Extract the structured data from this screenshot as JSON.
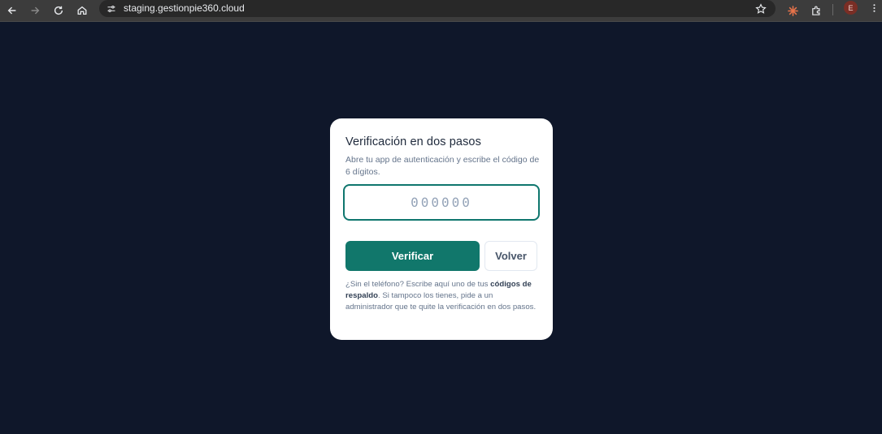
{
  "browser": {
    "url": "staging.gestionpie360.cloud",
    "profile_initial": "E",
    "profile_color": "#7a2e25"
  },
  "card": {
    "title": "Verificación en dos pasos",
    "subtitle": "Abre tu app de autenticación y escribe el código de 6 dígitos.",
    "code_input": {
      "value": "",
      "placeholder": "000000"
    },
    "verify_label": "Verificar",
    "back_label": "Volver",
    "help": {
      "part1": "¿Sin el teléfono? Escribe aquí uno de tus ",
      "link": "códigos de respaldo",
      "part2": ". Si tampoco los tienes, pide a un administrador que te quite la verificación en dos pasos."
    }
  },
  "colors": {
    "background": "#0f172a",
    "accent": "#11776b",
    "card": "#ffffff"
  }
}
